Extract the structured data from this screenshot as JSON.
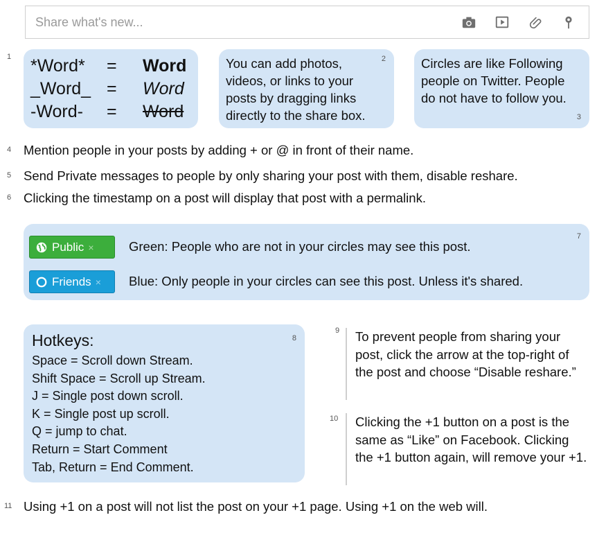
{
  "share": {
    "placeholder": "Share what's new...",
    "icons": [
      "camera-icon",
      "video-icon",
      "link-icon",
      "location-icon"
    ]
  },
  "tips": {
    "n1": "1",
    "formatting": {
      "rows": [
        {
          "syntax": "*Word*",
          "eq": "=",
          "result": "Word",
          "style": "bold"
        },
        {
          "syntax": "_Word_",
          "eq": "=",
          "result": "Word",
          "style": "italic"
        },
        {
          "syntax": "-Word-",
          "eq": "=",
          "result": "Word",
          "style": "strikethrough"
        }
      ]
    },
    "n2": "2",
    "tip2": "You can add photos, videos, or links to your posts by dragging links directly to the share box.",
    "n3": "3",
    "tip3": "Circles are like Following people on Twitter. People do not have to follow you.",
    "n4": "4",
    "tip4": "Mention people in your posts by adding + or @ in front of their name.",
    "n5": "5",
    "tip5": "Send Private messages to people by only sharing your post with them, disable reshare.",
    "n6": "6",
    "tip6": "Clicking the timestamp on a post will display that post with a permalink.",
    "n7": "7",
    "public_label": "Public",
    "public_x": "×",
    "public_desc": "Green: People who are not in your circles may see this post.",
    "friends_label": "Friends",
    "friends_x": "×",
    "friends_desc": "Blue: Only people in your circles can see this post. Unless it's shared.",
    "n8": "8",
    "hotkeys_title": "Hotkeys:",
    "hotkeys": [
      "Space = Scroll down Stream.",
      "Shift Space = Scroll up Stream.",
      "J = Single post down scroll.",
      "K = Single post up scroll.",
      "Q = jump to chat.",
      "Return = Start Comment",
      "Tab, Return = End Comment."
    ],
    "n9": "9",
    "tip9": "To prevent people from sharing your post, click the arrow at the top-right of the post and choose “Disable reshare.”",
    "n10": "10",
    "tip10": "Clicking the +1 button on a post is the same as “Like” on Facebook. Clicking the +1 button again, will remove your +1.",
    "n11": "11",
    "tip11": "Using +1 on a post will not list the post on your +1 page. Using +1 on the web will."
  },
  "colors": {
    "tip_box": "#d4e5f6",
    "public_green": "#3cae3c",
    "friends_blue": "#1a9ed8"
  }
}
